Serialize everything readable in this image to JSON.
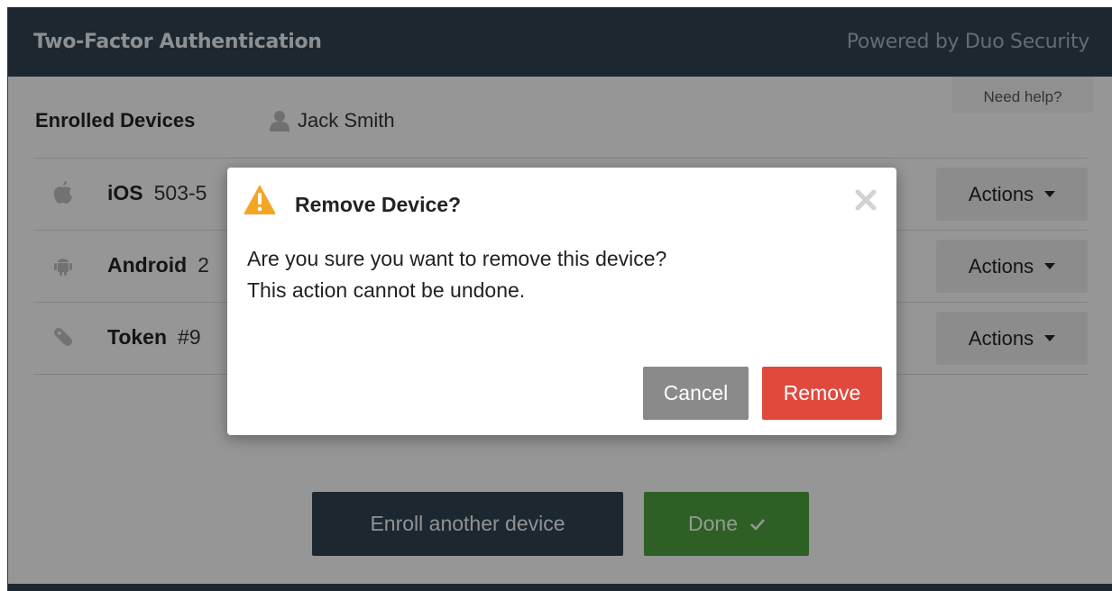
{
  "header": {
    "title": "Two-Factor Authentication",
    "powered_by": "Powered by Duo Security"
  },
  "help": {
    "label": "Need help?"
  },
  "enrolled": {
    "section_title": "Enrolled Devices",
    "user_name": "Jack Smith",
    "user_icon": "user-icon"
  },
  "devices": [
    {
      "name": "iOS",
      "detail": "503-5",
      "icon": "apple-icon",
      "actions_label": "Actions"
    },
    {
      "name": "Android",
      "detail": "2",
      "icon": "android-icon",
      "actions_label": "Actions"
    },
    {
      "name": "Token",
      "detail": "#9",
      "icon": "token-icon",
      "actions_label": "Actions"
    }
  ],
  "footer": {
    "enroll_label": "Enroll another device",
    "done_label": "Done"
  },
  "modal": {
    "title": "Remove Device?",
    "message_line1": "Are you sure you want to remove this device?",
    "message_line2": "This action cannot be undone.",
    "cancel_label": "Cancel",
    "remove_label": "Remove"
  },
  "colors": {
    "header_bg": "#303f4c",
    "done_green": "#4b9a3b",
    "remove_red": "#e0493c",
    "cancel_gray": "#8a8a8a",
    "warning_orange": "#f4a523"
  }
}
